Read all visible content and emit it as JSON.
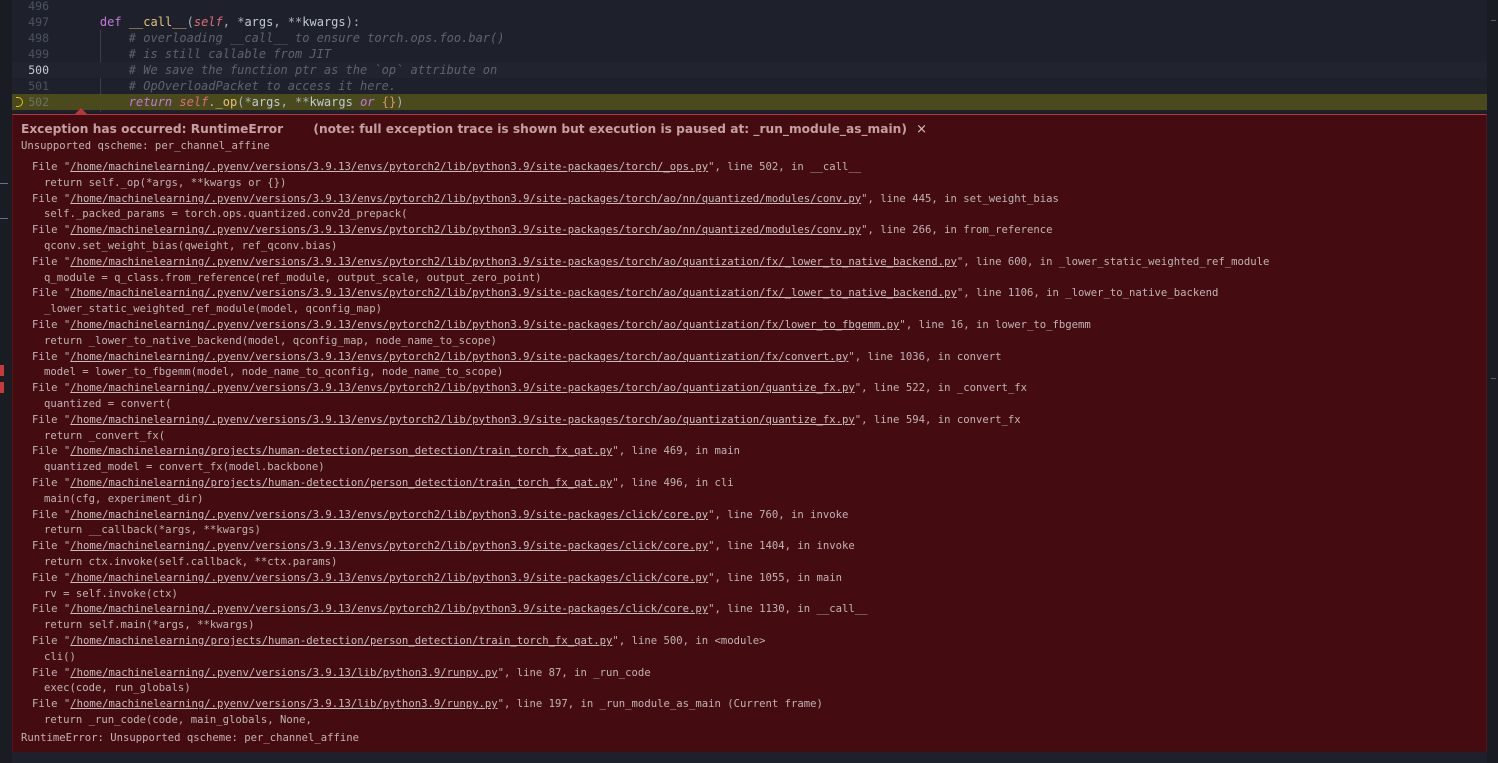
{
  "editor": {
    "lines": [
      {
        "number": "496",
        "tokens": []
      },
      {
        "number": "497",
        "tokens": [
          {
            "t": "    ",
            "c": "punc"
          },
          {
            "t": "def",
            "c": "kw"
          },
          {
            "t": " ",
            "c": "punc"
          },
          {
            "t": "__call__",
            "c": "fn"
          },
          {
            "t": "(",
            "c": "punc"
          },
          {
            "t": "self",
            "c": "self"
          },
          {
            "t": ", *",
            "c": "punc"
          },
          {
            "t": "args",
            "c": "op"
          },
          {
            "t": ", **",
            "c": "punc"
          },
          {
            "t": "kwargs",
            "c": "op"
          },
          {
            "t": "):",
            "c": "punc"
          }
        ]
      },
      {
        "number": "498",
        "tokens": [
          {
            "t": "        # overloading __call__ to ensure torch.ops.foo.bar()",
            "c": "cmt"
          }
        ]
      },
      {
        "number": "499",
        "tokens": [
          {
            "t": "        # is still callable from JIT",
            "c": "cmt"
          }
        ]
      },
      {
        "number": "500",
        "tokens": [
          {
            "t": "        # We save the function ptr as the `op` attribute on",
            "c": "cmt"
          }
        ]
      },
      {
        "number": "501",
        "tokens": [
          {
            "t": "        # OpOverloadPacket to access it here.",
            "c": "cmt"
          }
        ]
      },
      {
        "number": "502",
        "tokens": [
          {
            "t": "        ",
            "c": "punc"
          },
          {
            "t": "return",
            "c": "kwi"
          },
          {
            "t": " ",
            "c": "punc"
          },
          {
            "t": "self",
            "c": "self"
          },
          {
            "t": ".",
            "c": "punc"
          },
          {
            "t": "_op",
            "c": "fn"
          },
          {
            "t": "(*",
            "c": "punc"
          },
          {
            "t": "args",
            "c": "op"
          },
          {
            "t": ", **",
            "c": "punc"
          },
          {
            "t": "kwargs",
            "c": "op"
          },
          {
            "t": " ",
            "c": "punc"
          },
          {
            "t": "or",
            "c": "kwi"
          },
          {
            "t": " ",
            "c": "punc"
          },
          {
            "t": "{}",
            "c": "brace"
          },
          {
            "t": ")",
            "c": "punc"
          }
        ]
      }
    ],
    "cursor_line": "500",
    "paused_line": "502",
    "breakpoint_color": "#e5c100"
  },
  "exception": {
    "title": "Exception has occurred: RuntimeError",
    "note": "(note: full exception trace is shown but execution is paused at: _run_module_as_main)",
    "close_glyph": "×",
    "message": "Unsupported qscheme: per_channel_affine",
    "final": "RuntimeError: Unsupported qscheme: per_channel_affine",
    "frames": [
      {
        "path": "/home/machinelearning/.pyenv/versions/3.9.13/envs/pytorch2/lib/python3.9/site-packages/torch/_ops.py",
        "loc": ", line 502, in __call__",
        "code": "return self._op(*args, **kwargs or {})"
      },
      {
        "path": "/home/machinelearning/.pyenv/versions/3.9.13/envs/pytorch2/lib/python3.9/site-packages/torch/ao/nn/quantized/modules/conv.py",
        "loc": ", line 445, in set_weight_bias",
        "code": "self._packed_params = torch.ops.quantized.conv2d_prepack("
      },
      {
        "path": "/home/machinelearning/.pyenv/versions/3.9.13/envs/pytorch2/lib/python3.9/site-packages/torch/ao/nn/quantized/modules/conv.py",
        "loc": ", line 266, in from_reference",
        "code": "qconv.set_weight_bias(qweight, ref_qconv.bias)"
      },
      {
        "path": "/home/machinelearning/.pyenv/versions/3.9.13/envs/pytorch2/lib/python3.9/site-packages/torch/ao/quantization/fx/_lower_to_native_backend.py",
        "loc": ", line 600, in _lower_static_weighted_ref_module",
        "code": "q_module = q_class.from_reference(ref_module, output_scale, output_zero_point)"
      },
      {
        "path": "/home/machinelearning/.pyenv/versions/3.9.13/envs/pytorch2/lib/python3.9/site-packages/torch/ao/quantization/fx/_lower_to_native_backend.py",
        "loc": ", line 1106, in _lower_to_native_backend",
        "code": "_lower_static_weighted_ref_module(model, qconfig_map)"
      },
      {
        "path": "/home/machinelearning/.pyenv/versions/3.9.13/envs/pytorch2/lib/python3.9/site-packages/torch/ao/quantization/fx/lower_to_fbgemm.py",
        "loc": ", line 16, in lower_to_fbgemm",
        "code": "return _lower_to_native_backend(model, qconfig_map, node_name_to_scope)"
      },
      {
        "path": "/home/machinelearning/.pyenv/versions/3.9.13/envs/pytorch2/lib/python3.9/site-packages/torch/ao/quantization/fx/convert.py",
        "loc": ", line 1036, in convert",
        "code": "model = lower_to_fbgemm(model, node_name_to_qconfig, node_name_to_scope)"
      },
      {
        "path": "/home/machinelearning/.pyenv/versions/3.9.13/envs/pytorch2/lib/python3.9/site-packages/torch/ao/quantization/quantize_fx.py",
        "loc": ", line 522, in _convert_fx",
        "code": "quantized = convert("
      },
      {
        "path": "/home/machinelearning/.pyenv/versions/3.9.13/envs/pytorch2/lib/python3.9/site-packages/torch/ao/quantization/quantize_fx.py",
        "loc": ", line 594, in convert_fx",
        "code": "return _convert_fx("
      },
      {
        "path": "/home/machinelearning/projects/human-detection/person_detection/train_torch_fx_qat.py",
        "loc": ", line 469, in main",
        "code": "quantized_model = convert_fx(model.backbone)"
      },
      {
        "path": "/home/machinelearning/projects/human-detection/person_detection/train_torch_fx_qat.py",
        "loc": ", line 496, in cli",
        "code": "main(cfg, experiment_dir)"
      },
      {
        "path": "/home/machinelearning/.pyenv/versions/3.9.13/envs/pytorch2/lib/python3.9/site-packages/click/core.py",
        "loc": ", line 760, in invoke",
        "code": "return __callback(*args, **kwargs)"
      },
      {
        "path": "/home/machinelearning/.pyenv/versions/3.9.13/envs/pytorch2/lib/python3.9/site-packages/click/core.py",
        "loc": ", line 1404, in invoke",
        "code": "return ctx.invoke(self.callback, **ctx.params)"
      },
      {
        "path": "/home/machinelearning/.pyenv/versions/3.9.13/envs/pytorch2/lib/python3.9/site-packages/click/core.py",
        "loc": ", line 1055, in main",
        "code": "rv = self.invoke(ctx)"
      },
      {
        "path": "/home/machinelearning/.pyenv/versions/3.9.13/envs/pytorch2/lib/python3.9/site-packages/click/core.py",
        "loc": ", line 1130, in __call__",
        "code": "return self.main(*args, **kwargs)"
      },
      {
        "path": "/home/machinelearning/projects/human-detection/person_detection/train_torch_fx_qat.py",
        "loc": ", line 500, in <module>",
        "code": "cli()"
      },
      {
        "path": "/home/machinelearning/.pyenv/versions/3.9.13/lib/python3.9/runpy.py",
        "loc": ", line 87, in _run_code",
        "code": "exec(code, run_globals)"
      },
      {
        "path": "/home/machinelearning/.pyenv/versions/3.9.13/lib/python3.9/runpy.py",
        "loc": ", line 197, in _run_module_as_main (Current frame)",
        "code": "return _run_code(code, main_globals, None,"
      }
    ],
    "accent_color": "#b8373a",
    "background_color": "#440c10"
  }
}
